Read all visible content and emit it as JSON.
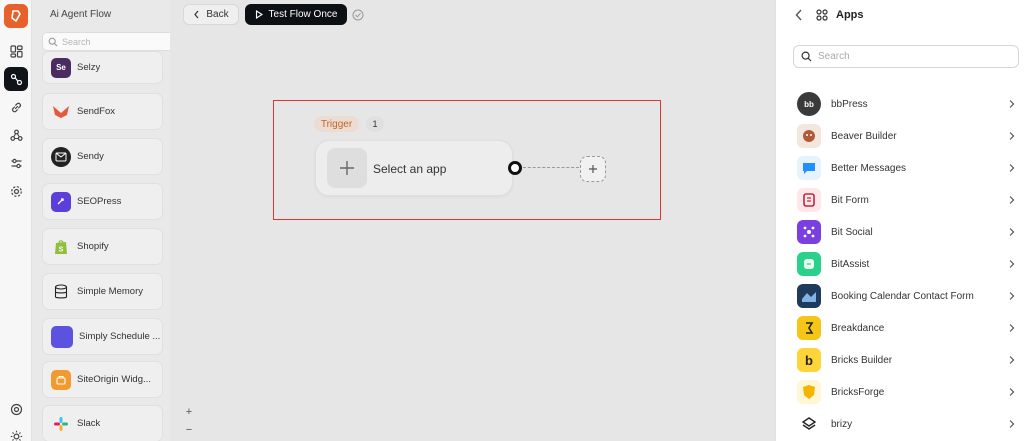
{
  "sidebar_left": {
    "title": "Ai Agent Flow",
    "search_placeholder": "Search",
    "apps": [
      {
        "label": "Selzy",
        "icon": "selzy-icon",
        "color": "#4a2c61",
        "glyph": "Se"
      },
      {
        "label": "SendFox",
        "icon": "sendfox-icon",
        "color": "#e25b3c",
        "glyph": ""
      },
      {
        "label": "Sendy",
        "icon": "sendy-icon",
        "color": "#222222",
        "glyph": ""
      },
      {
        "label": "SEOPress",
        "icon": "seopress-icon",
        "color": "#5b3fd8",
        "glyph": ""
      },
      {
        "label": "Shopify",
        "icon": "shopify-icon",
        "color": "#8fbf3d",
        "glyph": ""
      },
      {
        "label": "Simple Memory",
        "icon": "database-icon",
        "color": "#ffffff",
        "glyph": ""
      },
      {
        "label": "Simply Schedule ...",
        "icon": "simply-schedule-icon",
        "color": "#5b52e0",
        "glyph": ""
      },
      {
        "label": "SiteOrigin Widg...",
        "icon": "siteorigin-icon",
        "color": "#f29a2e",
        "glyph": ""
      },
      {
        "label": "Slack",
        "icon": "slack-icon",
        "color": "#ffffff",
        "glyph": ""
      }
    ]
  },
  "toolbar": {
    "back_label": "Back",
    "test_label": "Test Flow Once"
  },
  "flow": {
    "trigger_label": "Trigger",
    "trigger_count": "1",
    "node_label": "Select an app",
    "zoom_in": "+",
    "zoom_out": "−"
  },
  "apps_panel": {
    "title": "Apps",
    "search_placeholder": "Search",
    "items": [
      {
        "label": "bbPress",
        "icon": "bbpress-icon",
        "color": "#3a3a3a",
        "glyph": "bb"
      },
      {
        "label": "Beaver Builder",
        "icon": "beaver-builder-icon",
        "color": "#b05a3a",
        "glyph": ""
      },
      {
        "label": "Better Messages",
        "icon": "better-messages-icon",
        "color": "#1e90ff",
        "glyph": ""
      },
      {
        "label": "Bit Form",
        "icon": "bit-form-icon",
        "color": "#c0283a",
        "glyph": ""
      },
      {
        "label": "Bit Social",
        "icon": "bit-social-icon",
        "color": "#7b3fe0",
        "glyph": ""
      },
      {
        "label": "BitAssist",
        "icon": "bitassist-icon",
        "color": "#2bd18a",
        "glyph": ""
      },
      {
        "label": "Booking Calendar Contact Form",
        "icon": "booking-calendar-icon",
        "color": "#1f3a5a",
        "glyph": ""
      },
      {
        "label": "Breakdance",
        "icon": "breakdance-icon",
        "color": "#f5c518",
        "glyph": ""
      },
      {
        "label": "Bricks Builder",
        "icon": "bricks-builder-icon",
        "color": "#ffd43b",
        "glyph": "b"
      },
      {
        "label": "BricksForge",
        "icon": "bricksforge-icon",
        "color": "#f4b400",
        "glyph": ""
      },
      {
        "label": "brizy",
        "icon": "brizy-icon",
        "color": "#ffffff",
        "glyph": ""
      }
    ]
  },
  "colors": {
    "highlight": "#e03535",
    "accent": "#e8602c",
    "dark_button": "#0c0f14"
  }
}
